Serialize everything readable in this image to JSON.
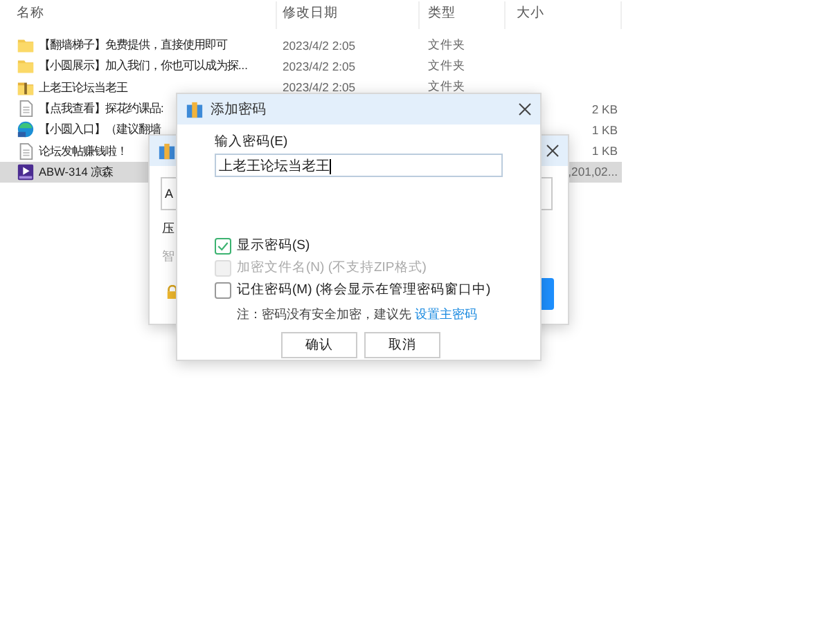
{
  "explorer": {
    "columns": [
      "名称",
      "修改日期",
      "类型",
      "大小"
    ],
    "files": [
      {
        "name": "【翻墙梯子】免费提供，直接使用即可",
        "date": "2023/4/2 2:05",
        "type": "文件夹",
        "kind": "folder",
        "selected": false
      },
      {
        "name": "【小圆展示】加入我们，你也可以成为探...",
        "date": "2023/4/2 2:05",
        "type": "文件夹",
        "kind": "folder",
        "selected": false
      },
      {
        "name": "上老王论坛当老王",
        "date": "2023/4/2 2:05",
        "type": "文件夹",
        "kind": "archive",
        "selected": false
      },
      {
        "name": "【点我查看】探花约课品:",
        "size": "2 KB",
        "kind": "document",
        "selected": false
      },
      {
        "name": "【小圆入口】（建议翻墙",
        "size": "1 KB",
        "kind": "web",
        "selected": false
      },
      {
        "name": "论坛发帖赚钱啦！",
        "size": "1 KB",
        "kind": "document",
        "selected": false
      },
      {
        "name": "ABW-314 凉森",
        "size": ",201,02...",
        "kind": "video",
        "selected": true
      }
    ]
  },
  "back_dialog": {
    "field_value": "A",
    "label_1": "压",
    "label_2": "智"
  },
  "dialog": {
    "title": "添加密码",
    "password_label": "输入密码(E)",
    "password": "上老王论坛当老王",
    "options": [
      {
        "label": "显示密码(S)",
        "checked": true,
        "disabled": false
      },
      {
        "label": "加密文件名(N) (不支持ZIP格式)",
        "checked": false,
        "disabled": true
      },
      {
        "label": "记住密码(M) (将会显示在管理密码窗口中)",
        "checked": false,
        "disabled": false
      }
    ],
    "note": "注：密码没有安全加密，建议先",
    "note_link": "设置主密码",
    "buttons": [
      "确认",
      "取消"
    ]
  }
}
